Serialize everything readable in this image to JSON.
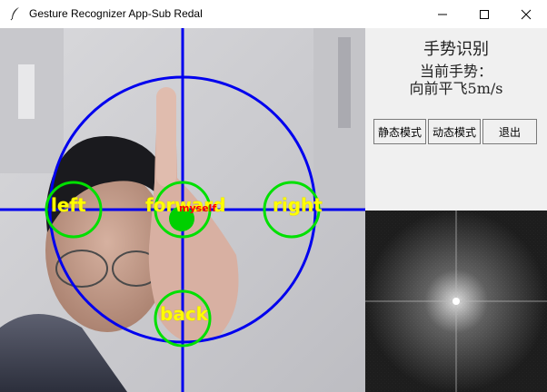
{
  "window": {
    "title": "Gesture Recognizer App-Sub Redal"
  },
  "window_controls": {
    "minimize": "minimize-icon",
    "maximize": "maximize-icon",
    "close": "close-icon"
  },
  "camera": {
    "labels": {
      "left": "left",
      "right": "right",
      "forward": "forward",
      "back": "back",
      "marker": "myself"
    },
    "colors": {
      "outer_ring": "#0000ee",
      "zone_ring": "#00e000",
      "label": "#ffff00",
      "marker": "#ff0000"
    }
  },
  "panel": {
    "title": "手势识别",
    "current_label": "当前手势：",
    "current_value": "向前平飞5m/s",
    "buttons": {
      "static_mode": "静态模式",
      "dynamic_mode": "动态模式",
      "exit": "退出"
    }
  }
}
